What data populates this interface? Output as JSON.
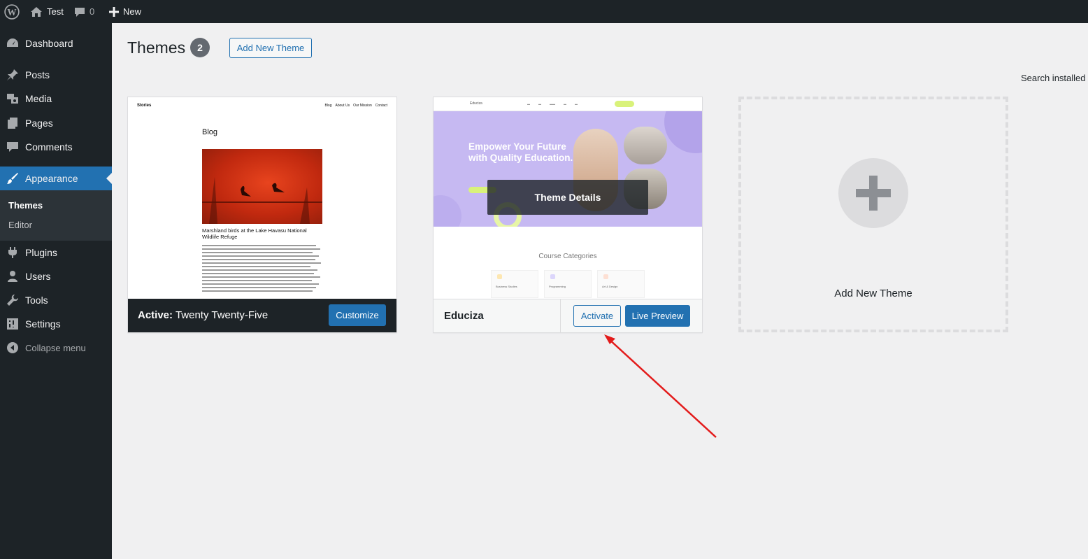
{
  "admin_bar": {
    "site_name": "Test",
    "comments_count": "0",
    "new_label": "New"
  },
  "sidebar": {
    "items": [
      {
        "label": "Dashboard",
        "icon": "dashboard-icon"
      },
      {
        "label": "Posts",
        "icon": "pin-icon"
      },
      {
        "label": "Media",
        "icon": "media-icon"
      },
      {
        "label": "Pages",
        "icon": "pages-icon"
      },
      {
        "label": "Comments",
        "icon": "comments-icon"
      },
      {
        "label": "Appearance",
        "icon": "paintbrush-icon",
        "current": true
      },
      {
        "label": "Plugins",
        "icon": "plugin-icon"
      },
      {
        "label": "Users",
        "icon": "users-icon"
      },
      {
        "label": "Tools",
        "icon": "wrench-icon"
      },
      {
        "label": "Settings",
        "icon": "settings-icon"
      }
    ],
    "submenu": [
      {
        "label": "Themes",
        "current": true
      },
      {
        "label": "Editor"
      }
    ],
    "collapse_label": "Collapse menu"
  },
  "page": {
    "title": "Themes",
    "count": "2",
    "add_new_button": "Add New Theme",
    "search_label": "Search installed t"
  },
  "themes": [
    {
      "active_prefix": "Active:",
      "name": "Twenty Twenty-Five",
      "action_label": "Customize",
      "screenshot": {
        "site_title": "Stories",
        "nav": [
          "Blog",
          "About Us",
          "Our Mission",
          "Contact"
        ],
        "heading": "Blog",
        "post_title": "Marshland birds at the Lake Havasu National Wildlife Refuge"
      }
    },
    {
      "name": "Educiza",
      "overlay_label": "Theme Details",
      "activate_label": "Activate",
      "preview_label": "Live Preview",
      "screenshot": {
        "hero_title": "Empower Your Future with Quality Education.",
        "section_title": "Course Categories",
        "cards": [
          "Business Studies",
          "Programming",
          "Art & Design"
        ]
      }
    }
  ],
  "add_new_card": {
    "label": "Add New Theme"
  },
  "colors": {
    "admin_dark": "#1d2327",
    "accent": "#2271b1",
    "background": "#f0f0f1",
    "annotation_arrow": "#e31b1b"
  }
}
